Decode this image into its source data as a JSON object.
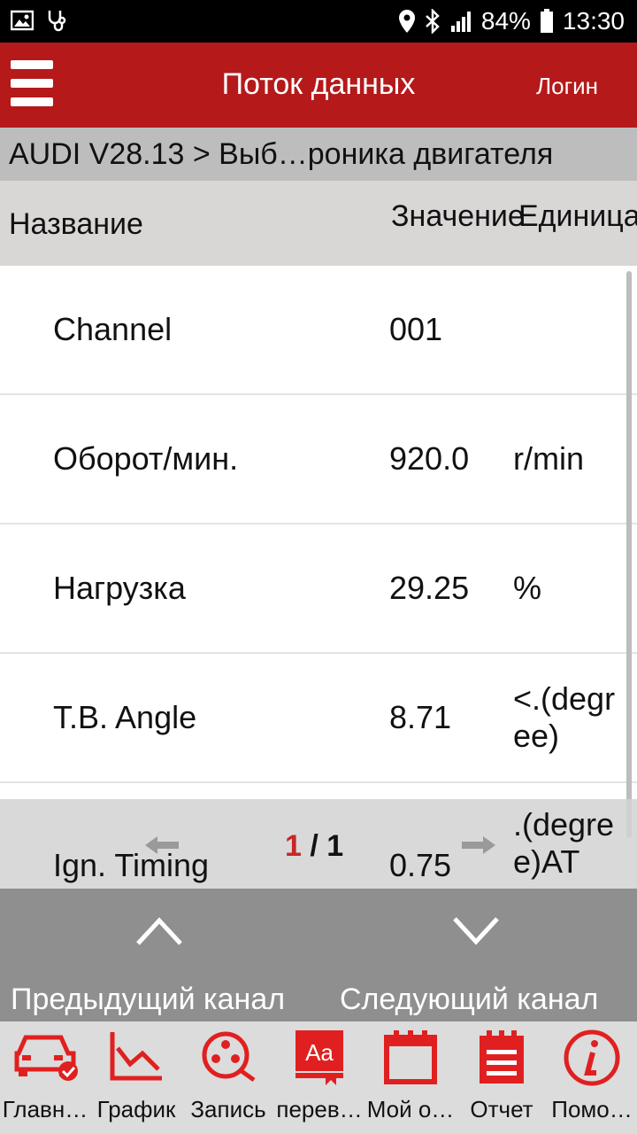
{
  "status": {
    "battery": "84%",
    "time": "13:30"
  },
  "appbar": {
    "title": "Поток данных",
    "login": "Логин"
  },
  "breadcrumb": "AUDI V28.13 > Выб…роника двигателя",
  "columns": {
    "name": "Название",
    "value": "Значение",
    "unit": "Единица"
  },
  "rows": [
    {
      "name": "Channel",
      "value": "001",
      "unit": ""
    },
    {
      "name": "Оборот/мин.",
      "value": "920.0",
      "unit": "r/min"
    },
    {
      "name": "Нагрузка",
      "value": "29.25",
      "unit": "%"
    },
    {
      "name": "T.B. Angle",
      "value": "8.71",
      "unit": "<.(degree)"
    },
    {
      "name": "Ign. Timing",
      "value": "0.75",
      "unit": ".(degree)AT"
    }
  ],
  "pager": {
    "current": "1",
    "sep": " / ",
    "total": "1"
  },
  "nav": {
    "prev": "Предыдущий канал",
    "next": "Следующий канал"
  },
  "tabs": [
    {
      "label": "Главн…",
      "icon": "car-check-icon"
    },
    {
      "label": "График",
      "icon": "graph-icon"
    },
    {
      "label": "Запись",
      "icon": "film-reel-icon"
    },
    {
      "label": "перев…",
      "icon": "translate-book-icon"
    },
    {
      "label": "Мой о…",
      "icon": "calendar-icon"
    },
    {
      "label": "Отчет",
      "icon": "report-icon"
    },
    {
      "label": "Помо…",
      "icon": "info-icon"
    }
  ],
  "colors": {
    "accent": "#b5191a",
    "icon_red": "#e02020"
  }
}
